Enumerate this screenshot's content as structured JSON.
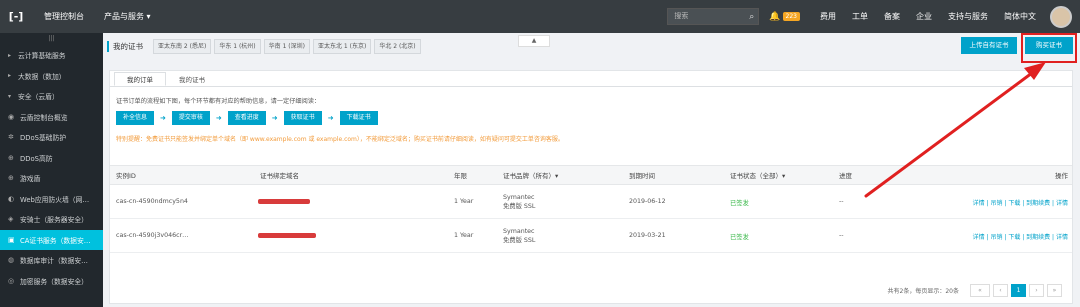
{
  "topbar": {
    "logo": "[-]",
    "console": "管理控制台",
    "products": "产品与服务 ▾",
    "search_placeholder": "搜索",
    "badge_count": "223",
    "links": [
      "费用",
      "工单",
      "备案",
      "企业",
      "支持与服务",
      "简体中文"
    ]
  },
  "sidebar": {
    "collapse": "|||",
    "items": [
      {
        "label": "云计算基础服务",
        "icon": "▸",
        "group": true
      },
      {
        "label": "大数据（数加）",
        "icon": "▸",
        "group": true
      },
      {
        "label": "安全（云盾）",
        "icon": "▾",
        "group": true
      },
      {
        "label": "云盾控制台概览",
        "icon": "◉"
      },
      {
        "label": "DDoS基础防护",
        "icon": "✲"
      },
      {
        "label": "DDoS高防",
        "icon": "⊕"
      },
      {
        "label": "游戏盾",
        "icon": "⊕"
      },
      {
        "label": "Web应用防火墙（网…",
        "icon": "◐"
      },
      {
        "label": "安骑士（服务器安全）",
        "icon": "◈"
      },
      {
        "label": "CA证书服务（数据安…",
        "icon": "▣",
        "active": true
      },
      {
        "label": "数据库审计（数据安…",
        "icon": "◍"
      },
      {
        "label": "加密服务（数据安全）",
        "icon": "◎"
      }
    ]
  },
  "toolbar": {
    "title": "我的证书",
    "regions": [
      "亚太东南 2 (悉尼)",
      "华东 1 (杭州)",
      "华南 1 (深圳)",
      "亚太东北 1 (东京)",
      "华北 2 (北京)"
    ],
    "collapse": "▲",
    "upload": "上传自有证书",
    "buy": "购买证书"
  },
  "tabs": [
    "我的订单",
    "我的证书"
  ],
  "hint": "证书订单的流程如下图，每个环节都有对应的帮助信息，请一定仔细阅读：",
  "steps": [
    "补全信息",
    "提交审核",
    "查看进度",
    "获取证书",
    "下载证书"
  ],
  "warn": "特别提醒：免费证书只能签发并绑定单个域名（即 www.example.com 或 example.com），不能绑定泛域名；购买证书前请仔细阅读，如有疑问可提交工单咨询客服。",
  "table": {
    "headers": [
      "实例ID",
      "证书绑定域名",
      "年限",
      "证书品牌（所有）▾",
      "到期时间",
      "证书状态（全部）▾",
      "进度",
      "操作"
    ],
    "rows": [
      {
        "id": "cas-cn-4590ndmcy5n4",
        "years": "1 Year",
        "brand": "Symantec",
        "brand2": "免费版 SSL",
        "expire": "2019-06-12",
        "status": "已签发",
        "progress": "--",
        "ops": "详情 | 吊销 | 下载 | 到期续费 | 详情"
      },
      {
        "id": "cas-cn-4590j3v046cr…",
        "years": "1 Year",
        "brand": "Symantec",
        "brand2": "免费版 SSL",
        "expire": "2019-03-21",
        "status": "已签发",
        "progress": "--",
        "ops": "详情 | 吊销 | 下载 | 到期续费 | 详情"
      }
    ]
  },
  "pager": {
    "total": "共有2条，每页显示：20条",
    "first": "«",
    "prev": "‹",
    "current": "1",
    "next": "›",
    "last": "»"
  },
  "colors": {
    "accent": "#00a2ca",
    "annotation": "#e02020",
    "status_ok": "#3ab84a"
  }
}
